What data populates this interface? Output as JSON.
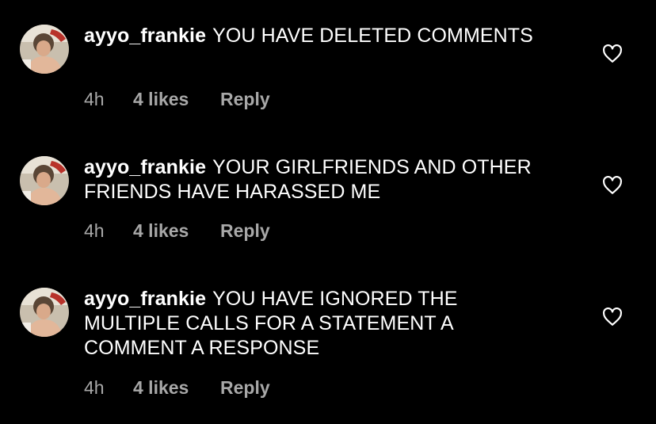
{
  "comments": [
    {
      "username": "ayyo_frankie",
      "text": "YOU HAVE DELETED COMMENTS",
      "time": "4h",
      "likes": "4 likes",
      "reply": "Reply"
    },
    {
      "username": "ayyo_frankie",
      "text": "YOUR GIRLFRIENDS AND OTHER FRIENDS HAVE HARASSED ME",
      "time": "4h",
      "likes": "4 likes",
      "reply": "Reply"
    },
    {
      "username": "ayyo_frankie",
      "text": "YOU HAVE IGNORED THE MULTIPLE CALLS FOR A STATEMENT A COMMENT A RESPONSE",
      "time": "4h",
      "likes": "4 likes",
      "reply": "Reply"
    }
  ],
  "icons": {
    "like": "heart-outline-icon"
  },
  "colors": {
    "background": "#000000",
    "text": "#ffffff",
    "secondary_text": "#a8a8a8"
  }
}
